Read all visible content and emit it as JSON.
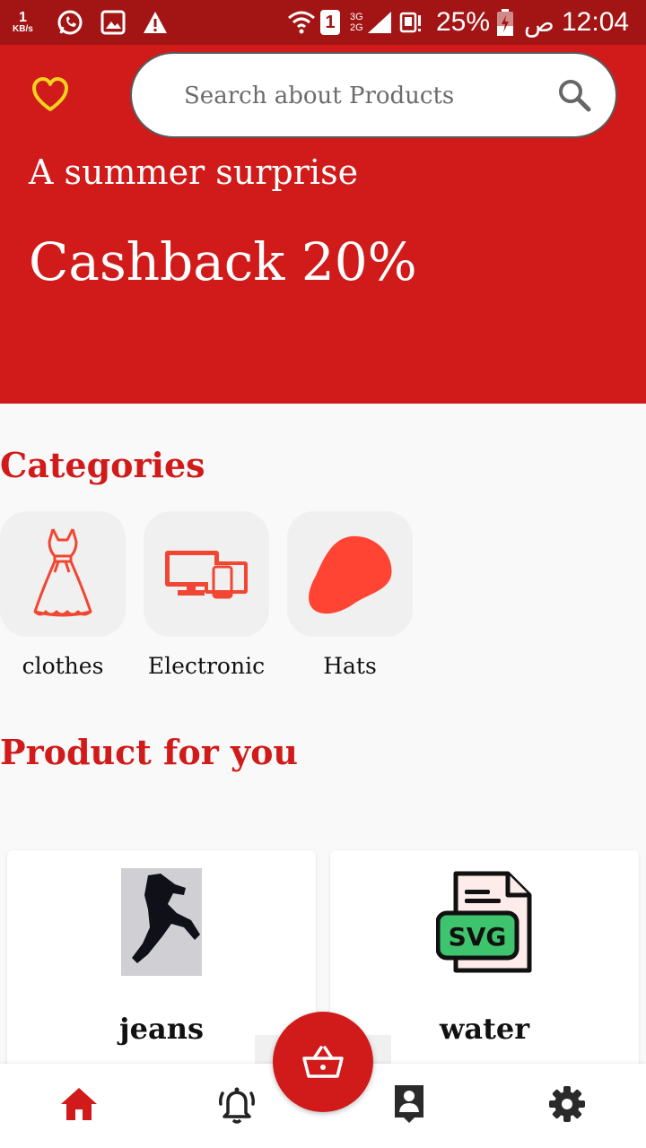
{
  "status_bar": {
    "net_speed_value": "1",
    "net_speed_unit": "KB/s",
    "sim_slot": "1",
    "network_top": "3G",
    "network_bottom": "2G",
    "battery": "25%",
    "am_pm": "ص",
    "time": "12:04"
  },
  "header": {
    "search_placeholder": "Search about Products",
    "promo_line1": "A summer surprise",
    "promo_line2": "Cashback 20%"
  },
  "categories": {
    "title": "Categories",
    "items": [
      {
        "label": "clothes",
        "icon": "dress-icon"
      },
      {
        "label": "Electronic",
        "icon": "devices-icon"
      },
      {
        "label": "Hats",
        "icon": "hat-icon"
      }
    ]
  },
  "products": {
    "title": "Product for you",
    "items": [
      {
        "name": "jeans",
        "image": "jeans-photo"
      },
      {
        "name": "water",
        "image": "svg-file-icon",
        "image_text": "SVG"
      }
    ]
  },
  "bottom_nav": {
    "items": [
      "home-icon",
      "notifications-icon",
      "profile-icon",
      "settings-icon"
    ],
    "center": "basket-icon"
  },
  "colors": {
    "primary": "#d11a1a",
    "status_bar": "#a31515",
    "favorite": "#f5d21f",
    "category_icon": "#f04632"
  }
}
